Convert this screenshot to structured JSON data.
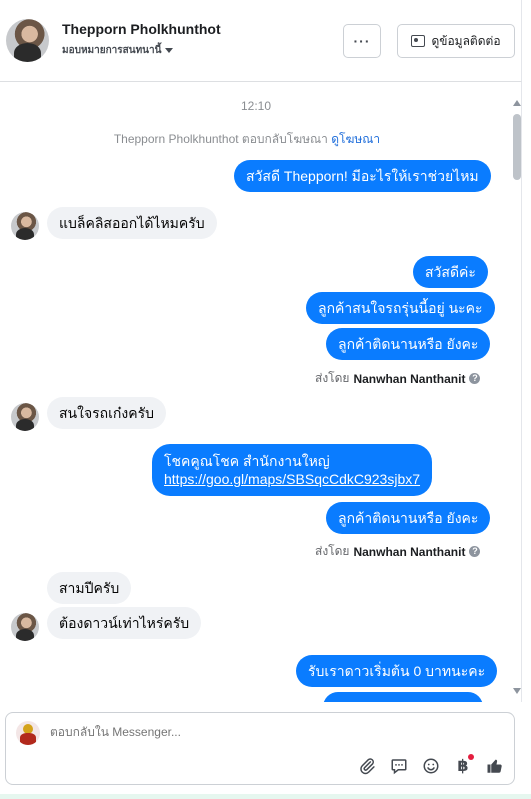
{
  "header": {
    "name": "Thepporn Pholkhunthot",
    "assign_label": "มอบหมายการสนทนานี้",
    "more_label": "···",
    "contact_label": "ดูข้อมูลติดต่อ"
  },
  "conversation": {
    "time": "12:10",
    "reply_note": "Thepporn Pholkhunthot ตอบกลับโฆษณา",
    "reply_link": "ดูโฆษณา",
    "messages": [
      {
        "dir": "out",
        "text": "สวัสดี Thepporn! มีอะไรให้เราช่วยไหม"
      },
      {
        "dir": "in",
        "text": "แบล็คลิสออกได้ไหมครับ"
      },
      {
        "dir": "out",
        "text": "สวัสดีค่ะ"
      },
      {
        "dir": "out",
        "text": "ลูกค้าสนใจรถรุ่นนี้อยู่ นะคะ"
      },
      {
        "dir": "out",
        "text": "ลูกค้าติดนานหรือ ยังคะ"
      },
      {
        "dir": "in",
        "text": "สนใจรถเก๋งครับ"
      },
      {
        "dir": "out",
        "text": "โชคคูณโชค สำนักงานใหญ่",
        "link": "https://goo.gl/maps/SBSqcCdkC923sjbx7"
      },
      {
        "dir": "out",
        "text": "ลูกค้าติดนานหรือ ยังคะ"
      },
      {
        "dir": "in",
        "text": "สามปีครับ"
      },
      {
        "dir": "in",
        "text": "ต้องดาวน์เท่าไหร่ครับ"
      },
      {
        "dir": "out",
        "text": "รับเราดาวเริ่มต้น 0 บาทนะคะ"
      }
    ],
    "sent_by_prefix": "ส่งโดย",
    "sent_by_name": "Nanwhan Nanthanit"
  },
  "composer": {
    "placeholder": "ตอบกลับใน Messenger..."
  },
  "icons": {
    "attach": "paperclip-icon",
    "saved_replies": "chat-bubble-icon",
    "emoji": "smiley-icon",
    "payment": "baht-icon",
    "like": "thumbs-up-icon"
  },
  "colors": {
    "outgoing_bubble": "#0a7cff",
    "incoming_bubble": "#f0f2f5",
    "link": "#216fdb"
  }
}
